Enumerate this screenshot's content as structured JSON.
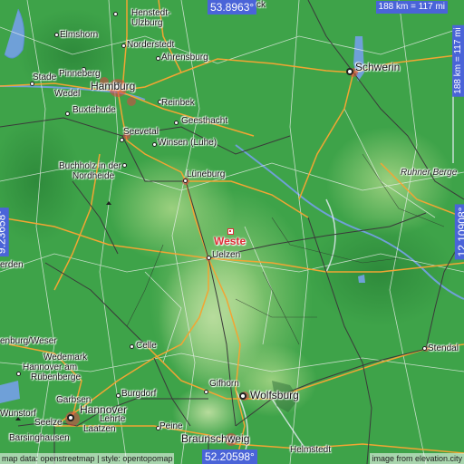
{
  "map": {
    "coords": {
      "top": "53.8963°",
      "bottom": "52.20598°",
      "left": "9.23658°",
      "right": "12.10908°"
    },
    "scale": {
      "horizontal": "188 km = 117 mi",
      "vertical": "188 km = 117 mi"
    },
    "attribution": {
      "left": "map data: openstreetmap | style: opentopomap",
      "right": "image from elevation.city"
    },
    "target": "Weste",
    "places": {
      "henstedt": "Henstedt-",
      "ulzburg": "Ulzburg",
      "elmshorn": "Elmshorn",
      "norderstedt": "Norderstedt",
      "ahrensburg": "Ahrensburg",
      "pinneberg": "Pinneberg",
      "stade": "Stade",
      "wedel": "Wedel",
      "hamburg": "Hamburg",
      "reinbek": "Reinbek",
      "buxtehude": "Buxtehude",
      "geesthacht": "Geesthacht",
      "seevetal": "Seevetal",
      "winsen": "Winsen (Luhe)",
      "buchholz": "Buchholz in der",
      "nordheide": "Nordheide",
      "luneburg": "Lüneburg",
      "uelzen": "Uelzen",
      "schwerin": "Schwerin",
      "ruhnerberge": "Ruhner Berge",
      "erden": "erden",
      "nienburg": "enburg/Weser",
      "celle": "Celle",
      "wedemark": "Wedemark",
      "hannoveram": "Hannover am",
      "rubenberge": "Rübenberge",
      "garbsen": "Garbsen",
      "burgdorf": "Burgdorf",
      "gifhorn": "Gifhorn",
      "wolfsburg": "Wolfsburg",
      "stendal": "Stendal",
      "hannover": "Hannover",
      "lehrte": "Lehrte",
      "seelze": "Seelze",
      "wunstorf": "Wunstorf",
      "laatzen": "Laatzen",
      "barsinghausen": "Barsinghausen",
      "peine": "Peine",
      "braunschweig": "Braunschweig",
      "helmstedt": "Helmstedt",
      "ck": "ck"
    }
  }
}
